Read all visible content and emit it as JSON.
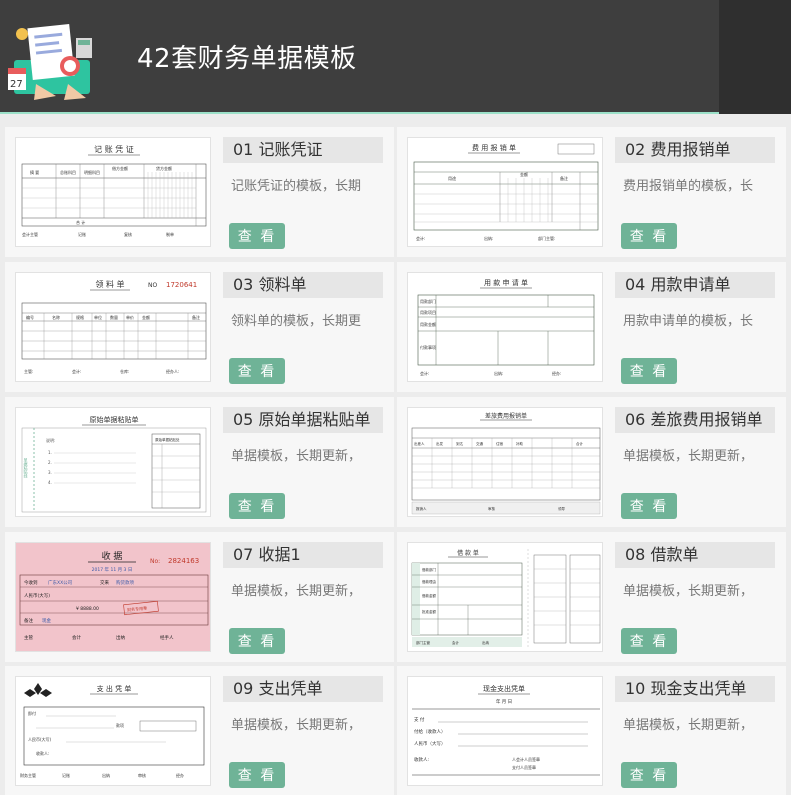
{
  "header": {
    "title": "42套财务单据模板"
  },
  "colors": {
    "header_bg": "#3e3e3e",
    "accent": "#6fb397",
    "card_bg": "#f7f7f7"
  },
  "cards": [
    {
      "name": "01 记账凭证",
      "desc": "记账凭证的模板，长期",
      "button": "查 看",
      "thumb": {
        "title": "记 账 凭 证",
        "header": [
          "摘 要",
          "总账科目",
          "明细科目",
          "借方金额",
          "贷方金额"
        ],
        "total": "合   计",
        "footer": [
          "会计主管",
          "记账",
          "复核",
          "制单"
        ]
      }
    },
    {
      "name": "02 费用报销单",
      "desc": "费用报销单的模板，长",
      "button": "查 看",
      "thumb": {
        "title": "费 用 报 销 单",
        "header": [
          "用途",
          "金额",
          "备注"
        ],
        "footer": [
          "会计:",
          "出纳:",
          "部门主管:"
        ]
      }
    },
    {
      "name": "03 领料单",
      "desc": "领料单的模板，长期更",
      "button": "查 看",
      "thumb": {
        "title": "领 料 单",
        "no_label": "NO",
        "no": "1720641",
        "header": [
          "编号",
          "名称",
          "规格",
          "单位",
          "数量",
          "单价",
          "金额",
          "备注"
        ],
        "footer": [
          "主管:",
          "会计:",
          "仓库:",
          "经办人:"
        ]
      }
    },
    {
      "name": "04 用款申请单",
      "desc": "用款申请单的模板，长",
      "button": "查 看",
      "thumb": {
        "title": "用 款 申 请 单",
        "rows": [
          "用款部门",
          "用款项目",
          "用款金额",
          "付款事项"
        ],
        "footer": [
          "会计:",
          "出纳:",
          "经办:"
        ]
      }
    },
    {
      "name": "05 原始单据粘贴单",
      "desc": "单据模板，长期更新，",
      "button": "查 看",
      "thumb": {
        "title": "原始单据粘贴单",
        "side": "单据粘贴线",
        "box": "原始单据粘贴处",
        "notes": [
          "说明:",
          "1.",
          "2.",
          "3.",
          "4."
        ]
      }
    },
    {
      "name": "06 差旅费用报销单",
      "desc": "单据模板，长期更新，",
      "button": "查 看",
      "thumb": {
        "title": "差旅费用报销单",
        "header": [
          "出差人",
          "出发",
          "到达",
          "交通",
          "住宿",
          "补助",
          "合计"
        ],
        "footer": [
          "报销人",
          "审核",
          "领导"
        ]
      }
    },
    {
      "name": "07 收据1",
      "desc": "单据模板，长期更新，",
      "button": "查 看",
      "thumb": {
        "title": "收 据",
        "no_label": "No:",
        "no": "2824163",
        "date": "2017  年  11  月  3  日",
        "from_label": "今收到",
        "from": "广东XX公司",
        "item_label": "交来",
        "item": "购货款项",
        "amount_label": "人民币(大写)",
        "amount": "¥ 8888.00",
        "stamp": "财务专用章",
        "note_label": "备注",
        "note": "现金",
        "footer": [
          "主管",
          "会计",
          "出纳",
          "经手人"
        ]
      }
    },
    {
      "name": "08 借款单",
      "desc": "单据模板，长期更新，",
      "button": "查 看",
      "thumb": {
        "title": "借 款 单",
        "rows": [
          "借款部门",
          "借款理由",
          "借款金额",
          "批准金额"
        ],
        "footer": [
          "部门主管",
          "会计",
          "出纳"
        ]
      }
    },
    {
      "name": "09 支出凭单",
      "desc": "单据模板，长期更新，",
      "button": "查 看",
      "thumb": {
        "title": "支 出 凭 单",
        "rows": [
          "即付",
          "款项",
          "人民币(大写)",
          "收款人:"
        ],
        "footer": [
          "财务主管",
          "记账",
          "出纳",
          "审核",
          "经办"
        ]
      }
    },
    {
      "name": "10 现金支出凭单",
      "desc": "单据模板，长期更新，",
      "button": "查 看",
      "thumb": {
        "title": "现金支出凭单",
        "date": "年    月    日",
        "rows": [
          "支    付",
          "付给（收款人）",
          "人民币（大写）",
          "收款人:"
        ],
        "footer": [
          "人会计人员签章",
          "支付人员签章"
        ]
      }
    }
  ]
}
